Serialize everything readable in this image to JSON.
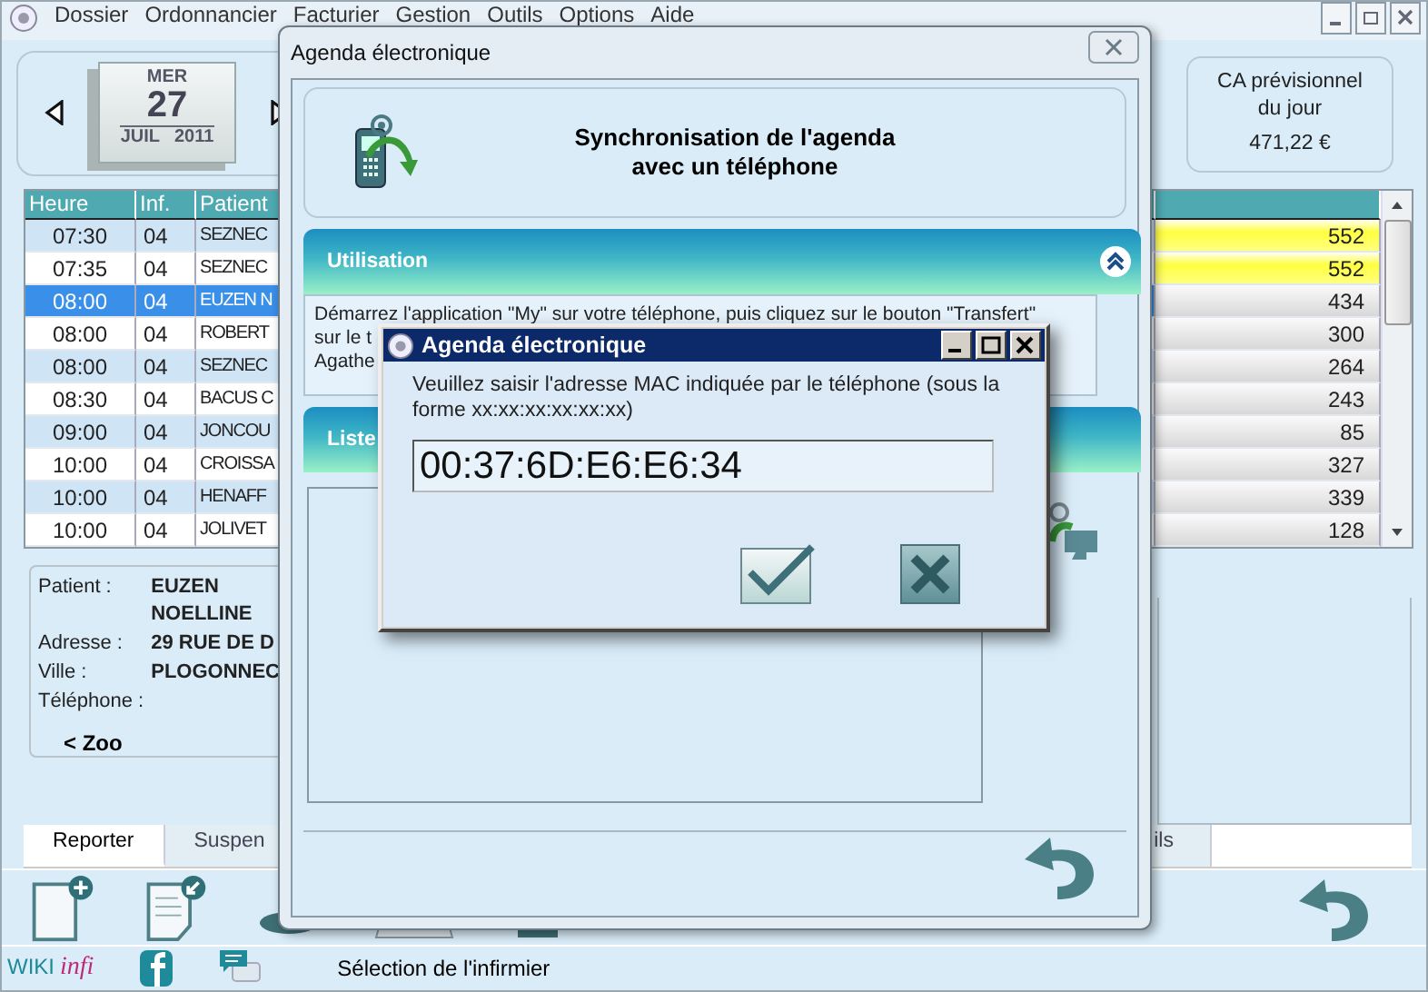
{
  "app": {
    "menu": [
      "Dossier",
      "Ordonnancier",
      "Facturier",
      "Gestion",
      "Outils",
      "Options",
      "Aide"
    ]
  },
  "calendar": {
    "weekday": "MER",
    "day": "27",
    "month": "JUIL",
    "year": "2011"
  },
  "revenue": {
    "label_lines": [
      "CA prévisionnel",
      "du jour"
    ],
    "amount": "471,22 €"
  },
  "table": {
    "columns": [
      "Heure",
      "Inf.",
      "Patient"
    ],
    "rows": [
      {
        "time": "07:30",
        "inf": "04",
        "patient": "SEZNEC",
        "value": "552",
        "selected": false,
        "highlight": true
      },
      {
        "time": "07:35",
        "inf": "04",
        "patient": "SEZNEC",
        "value": "552",
        "selected": false,
        "highlight": true
      },
      {
        "time": "08:00",
        "inf": "04",
        "patient": "EUZEN N",
        "value": "434",
        "selected": true,
        "highlight": false
      },
      {
        "time": "08:00",
        "inf": "04",
        "patient": "ROBERT",
        "value": "300",
        "selected": false,
        "highlight": false
      },
      {
        "time": "08:00",
        "inf": "04",
        "patient": "SEZNEC",
        "value": "264",
        "selected": false,
        "highlight": false
      },
      {
        "time": "08:30",
        "inf": "04",
        "patient": "BACUS C",
        "value": "243",
        "selected": false,
        "highlight": false
      },
      {
        "time": "09:00",
        "inf": "04",
        "patient": "JONCOU",
        "value": "85",
        "selected": false,
        "highlight": false
      },
      {
        "time": "10:00",
        "inf": "04",
        "patient": "CROISSA",
        "value": "327",
        "selected": false,
        "highlight": false
      },
      {
        "time": "10:00",
        "inf": "04",
        "patient": "HENAFF",
        "value": "339",
        "selected": false,
        "highlight": false
      },
      {
        "time": "10:00",
        "inf": "04",
        "patient": "JOLIVET",
        "value": "128",
        "selected": false,
        "highlight": false
      }
    ]
  },
  "patient_card": {
    "fields": [
      {
        "label": "Patient :",
        "value_lines": [
          "EUZEN",
          "NOELLINE"
        ]
      },
      {
        "label": "Adresse :",
        "value_lines": [
          "29 RUE DE D"
        ]
      },
      {
        "label": "Ville :",
        "value_lines": [
          "PLOGONNEC"
        ]
      },
      {
        "label": "Téléphone :"
      }
    ],
    "zoom_link": "< Zoo"
  },
  "tabs": [
    {
      "label": "Reporter",
      "selected": true
    },
    {
      "label": "Suspen",
      "selected": false
    },
    {
      "label": "ils",
      "selected": false
    }
  ],
  "status_bar": {
    "wiki": "WIKI",
    "infi": "infi",
    "text": "Sélection de l'infirmier"
  },
  "sync_dialog": {
    "title": "Agenda électronique",
    "heading_lines": [
      "Synchronisation de l'agenda",
      "avec un téléphone"
    ],
    "sections": [
      {
        "title": "Utilisation",
        "text_lines": [
          "Démarrez l'application \"My\" sur votre téléphone, puis cliquez sur le bouton \"Transfert\"",
          "sur le t",
          "Agathe"
        ]
      },
      {
        "title": "Liste"
      }
    ]
  },
  "mac_dialog": {
    "title": "Agenda électronique",
    "prompt": "Veuillez saisir l'adresse MAC indiquée par le téléphone (sous la forme xx:xx:xx:xx:xx:xx)",
    "value": "00:37:6D:E6:E6:34"
  }
}
